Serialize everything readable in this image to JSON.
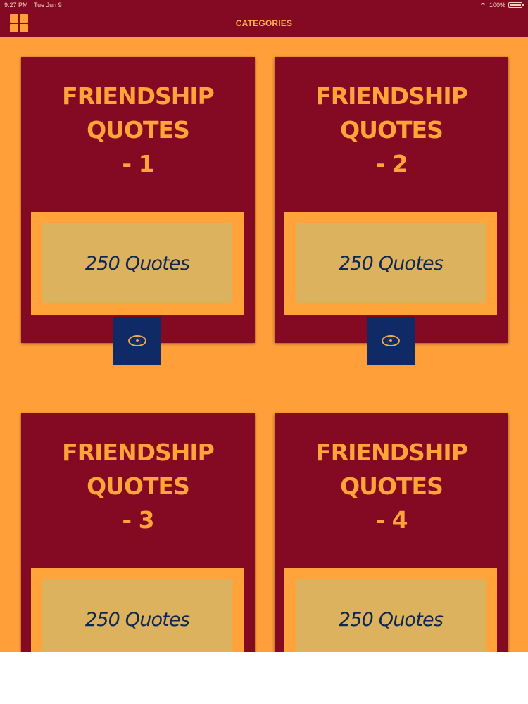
{
  "status": {
    "time": "9:27 PM",
    "date": "Tue Jun 9",
    "battery": "100%"
  },
  "header": {
    "title": "CATEGORIES",
    "menu_icon": "grid-icon"
  },
  "cards": [
    {
      "title_line1": "FRIENDSHIP QUOTES",
      "title_line2": "- 1",
      "count": "250 Quotes",
      "action_icon": "eye-icon"
    },
    {
      "title_line1": "FRIENDSHIP QUOTES",
      "title_line2": "- 2",
      "count": "250 Quotes",
      "action_icon": "eye-icon"
    },
    {
      "title_line1": "FRIENDSHIP QUOTES",
      "title_line2": "- 3",
      "count": "250 Quotes",
      "action_icon": "eye-icon"
    },
    {
      "title_line1": "FRIENDSHIP QUOTES",
      "title_line2": "- 4",
      "count": "250 Quotes",
      "action_icon": "eye-icon"
    }
  ],
  "colors": {
    "primary": "#830a22",
    "accent": "#ff9f3a",
    "count_box": "#ddb25e",
    "button": "#0f2a65",
    "text_dark": "#0f2650"
  }
}
